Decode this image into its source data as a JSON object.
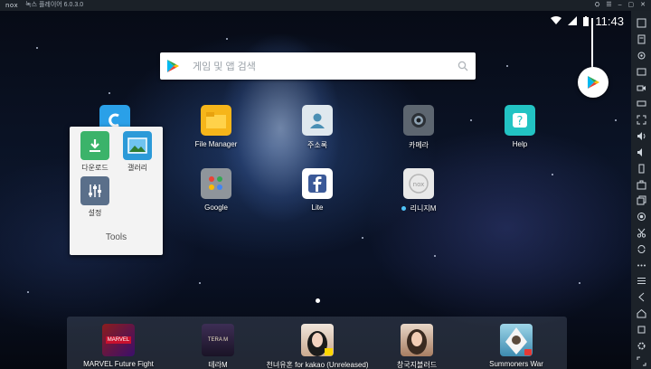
{
  "titlebar": {
    "logo": "nox",
    "title": "녹스 플레이어 6.0.3.0",
    "controls": [
      "⛭",
      "☰",
      "–",
      "▢",
      "✕"
    ]
  },
  "statusbar": {
    "clock": "11:43"
  },
  "search": {
    "placeholder": "게임 및 앱 검색"
  },
  "apps": [
    {
      "label": "File Manager"
    },
    {
      "label": "주소록"
    },
    {
      "label": "카메라"
    },
    {
      "label": "Help"
    },
    {
      "label": "Google"
    },
    {
      "label": "Lite"
    },
    {
      "label": "리니지M"
    }
  ],
  "folder": {
    "title": "Tools",
    "apps": [
      {
        "label": "다운로드"
      },
      {
        "label": "갤러리"
      },
      {
        "label": "설정"
      }
    ]
  },
  "dock": [
    {
      "label": "MARVEL Future Fight",
      "icon_text": "MARVEL"
    },
    {
      "label": "테라M",
      "icon_text": "TERA M"
    },
    {
      "label": "천녀유혼 for kakao (Unreleased)",
      "icon_text": ""
    },
    {
      "label": "창국지블러드",
      "icon_text": ""
    },
    {
      "label": "Summoners War",
      "icon_text": ""
    }
  ],
  "colors": {
    "accent_green": "#34a853",
    "folder_bg": "#f3f3f3",
    "toolbar_bg": "#1c2229",
    "title_bg": "#1b2128"
  }
}
